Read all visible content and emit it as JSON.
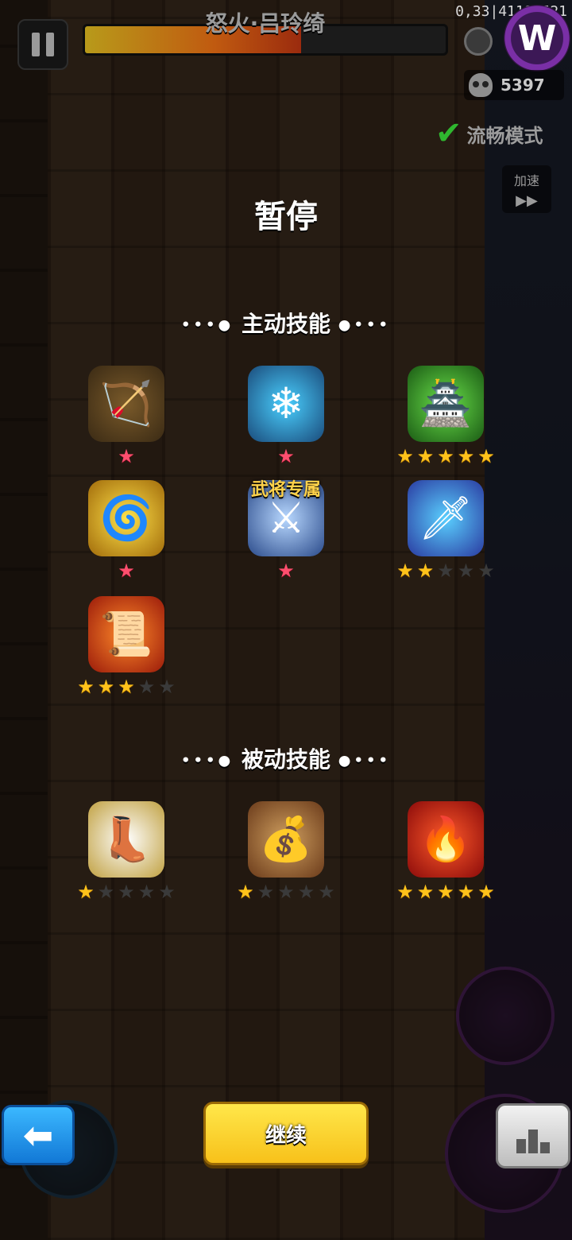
{
  "hud": {
    "boss_name": "怒火·吕玲绮",
    "boss_hp_fraction": 0.6,
    "coords_text": "0,33|41181521",
    "kill_count": "5397",
    "smooth_mode_label": "流畅模式",
    "speed_label": "加速",
    "speed_icon": "▶▶"
  },
  "pause": {
    "title": "暂停",
    "active_section": "主动技能",
    "passive_section": "被动技能",
    "exclusive_label": "武将专属",
    "active_skills": [
      {
        "icon": "crossbow-icon",
        "glyph": "🏹",
        "stars": 1,
        "max_stars": 1,
        "star_type": "pink"
      },
      {
        "icon": "ice-bow-icon",
        "glyph": "❄",
        "stars": 1,
        "max_stars": 1,
        "star_type": "pink"
      },
      {
        "icon": "poison-tower-icon",
        "glyph": "🏯",
        "stars": 5,
        "max_stars": 5,
        "star_type": "gold"
      },
      {
        "icon": "golden-ring-icon",
        "glyph": "🌀",
        "stars": 1,
        "max_stars": 1,
        "star_type": "pink"
      },
      {
        "icon": "halberd-icon",
        "glyph": "⚔",
        "stars": 1,
        "max_stars": 1,
        "star_type": "pink"
      },
      {
        "icon": "twin-swords-icon",
        "glyph": "🗡",
        "stars": 2,
        "max_stars": 5,
        "star_type": "gold"
      },
      {
        "icon": "fire-scroll-icon",
        "glyph": "📜",
        "stars": 3,
        "max_stars": 5,
        "star_type": "gold"
      }
    ],
    "passive_skills": [
      {
        "icon": "boots-icon",
        "glyph": "👢",
        "stars": 1,
        "max_stars": 5,
        "star_type": "gold"
      },
      {
        "icon": "money-bag-icon",
        "glyph": "💰",
        "stars": 1,
        "max_stars": 5,
        "star_type": "gold"
      },
      {
        "icon": "fire-orb-icon",
        "glyph": "🔥",
        "stars": 5,
        "max_stars": 5,
        "star_type": "gold"
      }
    ]
  },
  "buttons": {
    "back_icon": "arrow-left-icon",
    "continue_label": "继续",
    "rank_icon": "podium-icon"
  },
  "colors": {
    "gold_star": "#ffc21a",
    "pink_star": "#ff4e6e",
    "continue_yellow": "#ffe74a",
    "back_blue": "#1278d6"
  }
}
